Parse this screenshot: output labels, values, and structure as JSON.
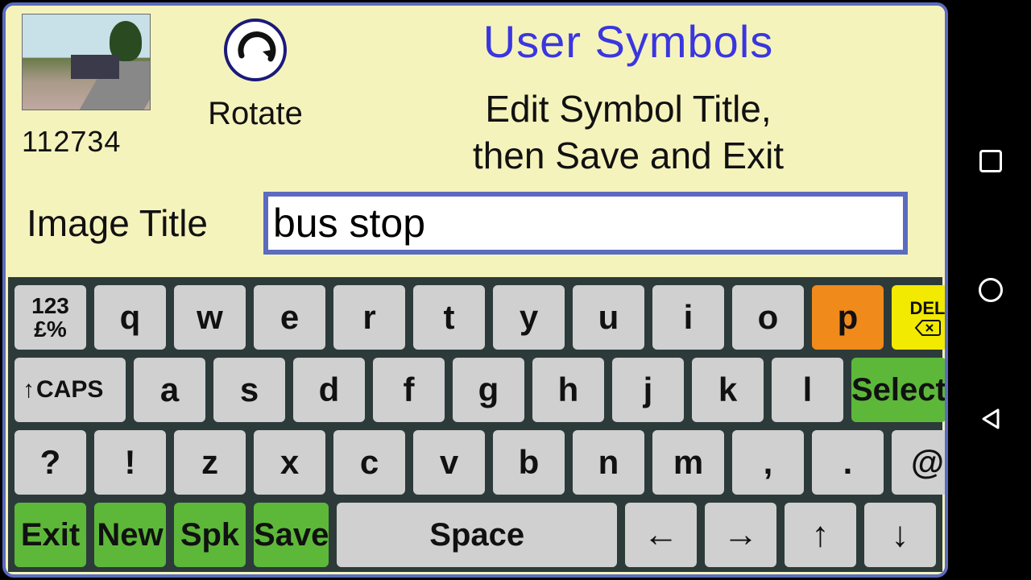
{
  "header": {
    "page_title": "User Symbols",
    "instruction_line1": "Edit Symbol Title,",
    "instruction_line2": "then Save and Exit",
    "rotate_label": "Rotate",
    "image_id": "112734"
  },
  "form": {
    "title_label": "Image Title",
    "title_value": "bus stop"
  },
  "keyboard": {
    "row1_sym": "123\n£%",
    "row1": [
      "q",
      "w",
      "e",
      "r",
      "t",
      "y",
      "u",
      "i",
      "o",
      "p"
    ],
    "del_label": "DEL",
    "caps_label": "CAPS",
    "row2": [
      "a",
      "s",
      "d",
      "f",
      "g",
      "h",
      "j",
      "k",
      "l"
    ],
    "select_label": "Select",
    "row3_pre": [
      "?",
      "!"
    ],
    "row3": [
      "z",
      "x",
      "c",
      "v",
      "b",
      "n",
      "m",
      ",",
      ".",
      "@"
    ],
    "actions": {
      "exit": "Exit",
      "new": "New",
      "spk": "Spk",
      "save": "Save",
      "space": "Space"
    },
    "arrows": {
      "left": "←",
      "right": "→",
      "up": "↑",
      "down": "↓"
    }
  },
  "colors": {
    "accent": "#5b6bc0",
    "bg": "#f5f3bc",
    "green": "#5db83a",
    "orange": "#f08a1a",
    "yellow": "#f2ea00"
  }
}
